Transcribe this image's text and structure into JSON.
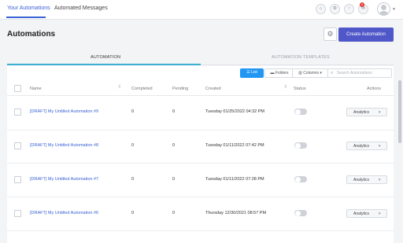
{
  "topnav": {
    "tabs": [
      {
        "label": "Your Automations",
        "active": true
      },
      {
        "label": "Automated Messages",
        "active": false
      }
    ],
    "notification_count": "9"
  },
  "header": {
    "title": "Automations",
    "create_button": "Create Automation"
  },
  "section_tabs": [
    {
      "label": "AUTOMATION",
      "active": true
    },
    {
      "label": "AUTOMATION TEMPLATES",
      "active": false
    }
  ],
  "toolbar": {
    "list_label": "List",
    "folders_label": "Folders",
    "columns_label": "Columns",
    "search_placeholder": "Search Automations"
  },
  "table": {
    "columns": [
      "Name",
      "Completed",
      "Pending",
      "Created",
      "Status",
      "Actions"
    ],
    "rows": [
      {
        "name": "[DRAFT] My Untitled Automation #9",
        "completed": "0",
        "pending": "0",
        "created": "Tuesday 01/25/2022 04:32 PM",
        "status": "off",
        "action": "Analytics"
      },
      {
        "name": "[DRAFT] My Untitled Automation #8",
        "completed": "0",
        "pending": "0",
        "created": "Tuesday 01/11/2022 07:42 PM",
        "status": "off",
        "action": "Analytics"
      },
      {
        "name": "[DRAFT] My Untitled Automation #7",
        "completed": "0",
        "pending": "0",
        "created": "Tuesday 01/11/2022 07:28 PM",
        "status": "off",
        "action": "Analytics"
      },
      {
        "name": "[DRAFT] My Untitled Automation #6",
        "completed": "0",
        "pending": "0",
        "created": "Thursday 12/30/2021 08:57 PM",
        "status": "off",
        "action": "Analytics"
      }
    ]
  },
  "colors": {
    "accent": "#3b63d6",
    "primary_button": "#4f57c9",
    "list_button": "#2196f3",
    "active_tab_line": "#3bb0d0"
  }
}
